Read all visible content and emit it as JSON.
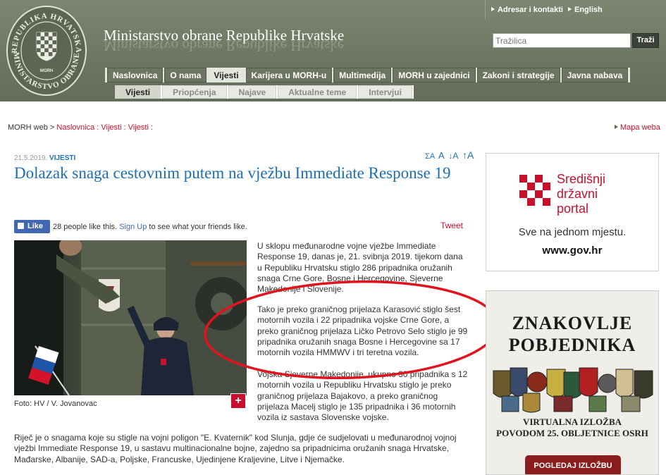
{
  "header": {
    "seal_text_top": "REPUBLIKA HRVATSKA",
    "seal_text_bottom": "MINISTARSTVO OBRANE",
    "seal_morh": "MORH",
    "site_title": "Ministarstvo obrane Republike Hrvatske",
    "top_links": [
      "Adresar i kontakti",
      "English"
    ],
    "search_placeholder": "Tražilica",
    "search_button": "Traži"
  },
  "main_nav": [
    {
      "label": "Naslovnica",
      "active": false
    },
    {
      "label": "O nama",
      "active": false
    },
    {
      "label": "Vijesti",
      "active": true
    },
    {
      "label": "Karijera u MORH-u",
      "active": false
    },
    {
      "label": "Multimedija",
      "active": false
    },
    {
      "label": "MORH u zajednici",
      "active": false
    },
    {
      "label": "Zakoni i strategije",
      "active": false
    },
    {
      "label": "Javna nabava",
      "active": false
    }
  ],
  "sub_nav": [
    {
      "label": "Vijesti",
      "active": true
    },
    {
      "label": "Priopćenja",
      "active": false
    },
    {
      "label": "Najave",
      "active": false
    },
    {
      "label": "Aktualne teme",
      "active": false
    },
    {
      "label": "Intervjui",
      "active": false
    }
  ],
  "breadcrumb": {
    "root": "MORH web",
    "sep": ">",
    "items": [
      "Naslovnica",
      "Vijesti",
      "Vijesti"
    ],
    "colon": ":"
  },
  "map_link": "Mapa weba",
  "article": {
    "date": "21.5.2019,",
    "category": "VIJESTI",
    "font_tools": [
      "ΣA",
      "A",
      "↓A",
      "↑A"
    ],
    "headline": "Dolazak snaga cestovnim putem na vježbu Immediate Response 19",
    "like_label": "Like",
    "like_count_text": "28 people like this.",
    "like_signup": "Sign Up",
    "like_suffix": "to see what your friends like.",
    "tweet": "Tweet",
    "caption": "Foto: HV / V. Jovanovac",
    "zoom": "+",
    "paragraphs": [
      "U sklopu međunarodne vojne vježbe Immediate Response 19, danas je, 21. svibnja 2019. tijekom dana u Republiku Hrvatsku stiglo 286 pripadnika oružanih snaga Crne Gore, Bosne i Hercegovine, Sjeverne Makedonije i Slovenije.",
      "Tako je preko graničnog prijelaza Karasović stiglo šest motornih vozila i 22 pripadnika vojske Crne Gore, a preko graničnog prijelaza Ličko Petrovo Selo stiglo je 99 pripadnika oružanih snaga Bosne i Hercegovine sa 17 motornih vozila HMMWV i tri teretna vozila.",
      "Vojska Sjeverne Makedonije, ukupno 30 pripadnika s 12 motornih vozila u Republiku Hrvatsku stiglo je preko graničnog  prijelaza Bajakovo, a preko graničnog prijelaza  Macelj stiglo je 135 pripadnika i 36 motornih vozila iz sastava Slovenske vojske.",
      "Riječ je o snagama koje su stigle na vojni poligon \"E. Kvaternik\" kod Slunja, gdje će sudjelovati u međunarodnoj vojnoj vježbi Immediate Response 19, u sastavu multinacionalne bojne, zajedno sa pripadnicima oružanih snaga Hrvatske, Mađarske, Albanije, SAD-a, Poljske, Francuske, Ujedinjene Kraljevine, Litve i Njemačke."
    ]
  },
  "banner_gov": {
    "title_lines": [
      "Središnji",
      "državni",
      "portal"
    ],
    "subtitle": "Sve na jednom mjestu.",
    "url": "www.gov.hr"
  },
  "banner_znakovlje": {
    "title_lines": [
      "ZNAKOVLJE",
      "POBJEDNIKA"
    ],
    "sub_lines": [
      "VIRTUALNA IZLOŽBA",
      "POVODOM 25. OBLJETNICE OSRH"
    ],
    "button": "POGLEDAJ IZLOŽBU"
  },
  "colors": {
    "header_green": "#6e7763",
    "link_blue": "#1b6eb3",
    "accent_red": "#c8102e",
    "annotation_red": "#e0141e"
  }
}
